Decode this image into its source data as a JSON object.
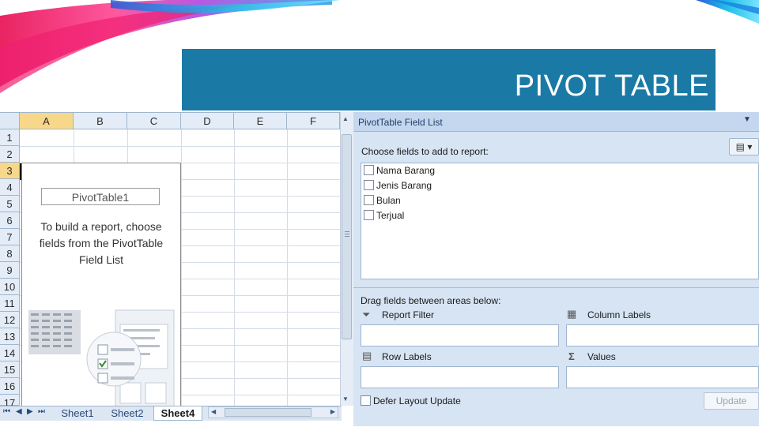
{
  "slide": {
    "title": "PIVOT TABLE"
  },
  "sheet": {
    "columns": [
      "A",
      "B",
      "C",
      "D",
      "E",
      "F"
    ],
    "rows": [
      "1",
      "2",
      "3",
      "4",
      "5",
      "6",
      "7",
      "8",
      "9",
      "10",
      "11",
      "12",
      "13",
      "14",
      "15",
      "16",
      "17"
    ],
    "active_column": "A",
    "active_row": "3",
    "pivot_name": "PivotTable1",
    "pivot_help": "To build a report, choose fields from the PivotTable Field List",
    "tabs": [
      "Sheet1",
      "Sheet2",
      "Sheet4"
    ],
    "active_tab": "Sheet4"
  },
  "field_list": {
    "title": "PivotTable Field List",
    "choose_label": "Choose fields to add to report:",
    "fields": [
      "Nama Barang",
      "Jenis Barang",
      "Bulan",
      "Terjual"
    ],
    "drag_label": "Drag fields between areas below:",
    "areas": {
      "report_filter": "Report Filter",
      "column_labels": "Column Labels",
      "row_labels": "Row Labels",
      "values": "Values"
    },
    "defer_label": "Defer Layout Update",
    "update_label": "Update"
  },
  "colors": {
    "banner": "#1a7aa5",
    "active_header": "#f7d88a",
    "panel_bg": "#d6e4f3"
  }
}
